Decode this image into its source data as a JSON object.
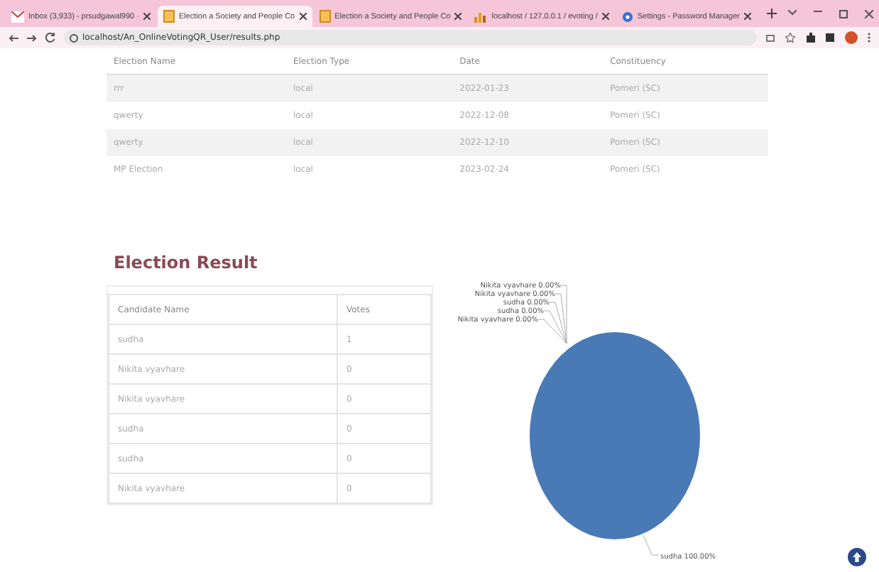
{
  "browser": {
    "tabs": [
      {
        "title": "Inbox (3,933) - prsudgawal990 ·",
        "selected": false
      },
      {
        "title": "Election a Society and People Co",
        "selected": true
      },
      {
        "title": "Election a Society and People Co",
        "selected": false
      },
      {
        "title": "localhost / 127.0.0.1 / evoting /",
        "selected": false
      },
      {
        "title": "Settings - Password Manager",
        "selected": false
      }
    ],
    "address": "localhost/An_OnlineVotingQR_User/results.php"
  },
  "elections": {
    "columns": [
      "Election Name",
      "Election Type",
      "Date",
      "Constituency"
    ],
    "rows": [
      [
        "rrr",
        "local",
        "2022-01-23",
        "Pomeri (SC)"
      ],
      [
        "qwerty",
        "local",
        "2022-12-08",
        "Pomeri (SC)"
      ],
      [
        "qwerty",
        "local",
        "2022-12-10",
        "Pomeri (SC)"
      ],
      [
        "MP Election",
        "local",
        "2023-02-24",
        "Pomeri (SC)"
      ]
    ]
  },
  "result": {
    "title": "Election Result",
    "columns": [
      "Candidate Name",
      "Votes"
    ],
    "rows": [
      [
        "sudha",
        "1"
      ],
      [
        "Nikita vyavhare",
        "0"
      ],
      [
        "Nikita vyavhare",
        "0"
      ],
      [
        "sudha",
        "0"
      ],
      [
        "sudha",
        "0"
      ],
      [
        "Nikita vyavhare",
        "0"
      ]
    ],
    "chart_data": {
      "type": "pie",
      "categories": [
        "sudha",
        "Nikita vyavhare",
        "Nikita vyavhare",
        "sudha",
        "sudha",
        "Nikita vyavhare"
      ],
      "values": [
        1,
        0,
        0,
        0,
        0,
        0
      ],
      "value_labels": [
        "100.00%",
        "0.00%",
        "0.00%",
        "0.00%",
        "0.00%",
        "0.00%"
      ]
    }
  }
}
